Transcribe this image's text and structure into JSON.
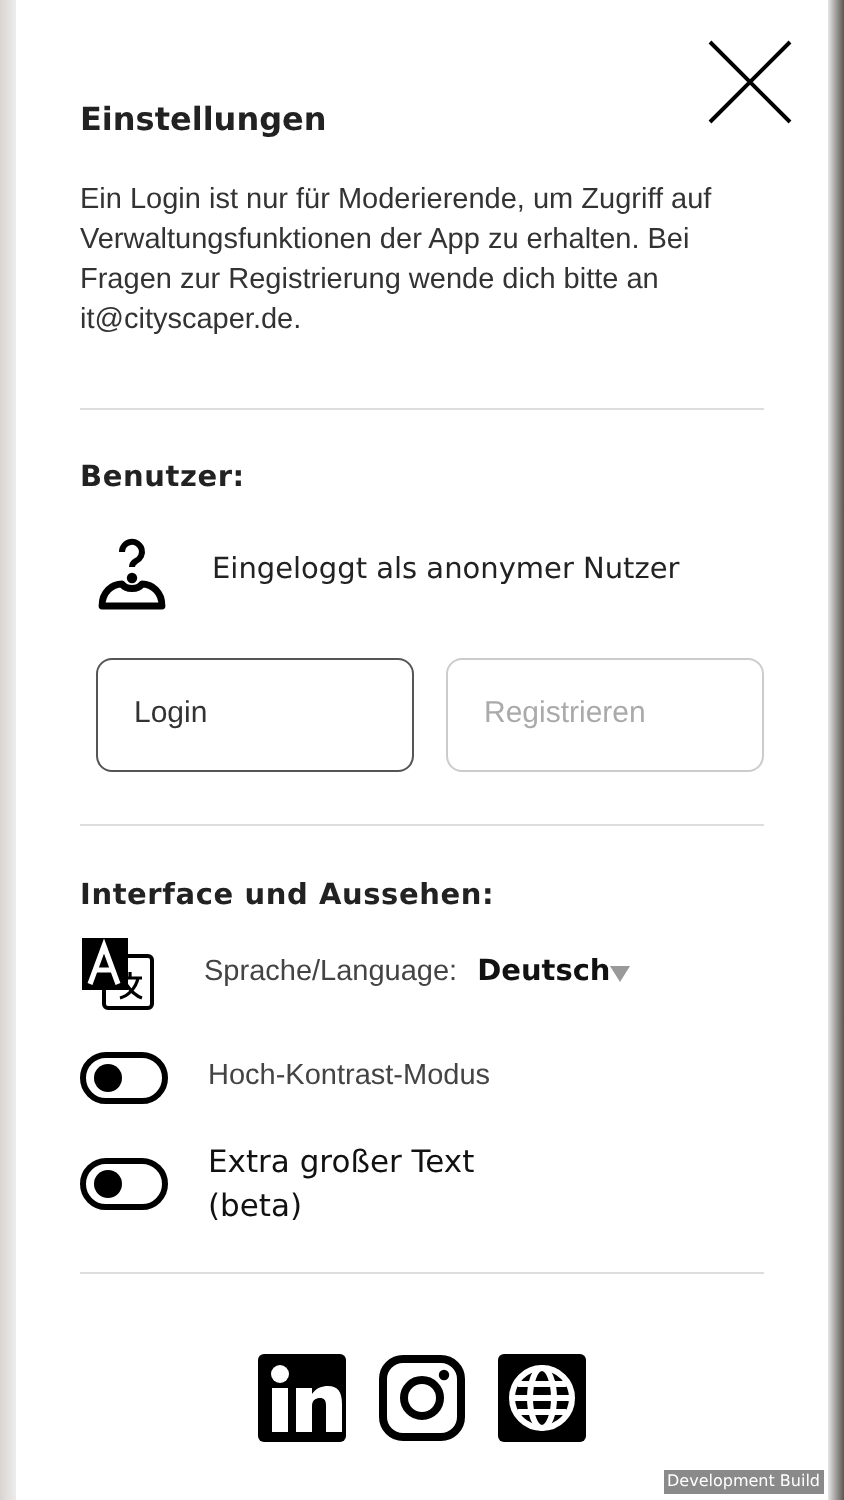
{
  "title": "Einstellungen",
  "intro": "Ein Login ist nur für Moderierende, um Zugriff auf Verwaltungsfunktionen der App zu erhalten. Bei Fragen zur Registrierung wende dich bitte an it@cityscaper.de.",
  "user_section": {
    "heading": "Benutzer:",
    "status": "Eingeloggt als anonymer Nutzer",
    "buttons": [
      {
        "label": "Login",
        "disabled": false
      },
      {
        "label": "Registrieren",
        "disabled": true
      }
    ]
  },
  "interface_section": {
    "heading": "Interface und Aussehen:",
    "language_label": "Sprache/Language:",
    "language_value": "Deutsch",
    "toggles": [
      {
        "label": "Hoch-Kontrast-Modus",
        "on": false,
        "kind": "plain"
      },
      {
        "label": "Extra großer Text (beta)",
        "on": false,
        "kind": "large"
      }
    ]
  },
  "build_label": "Development Build"
}
